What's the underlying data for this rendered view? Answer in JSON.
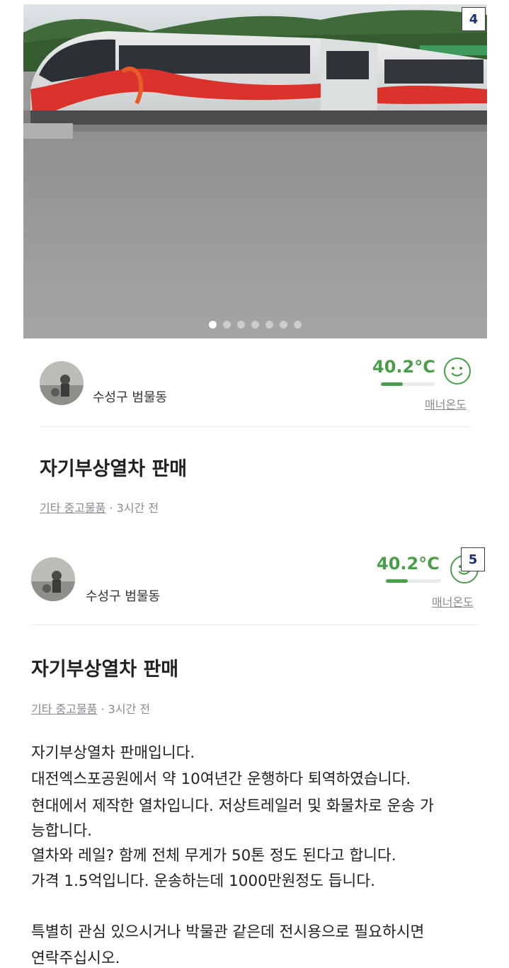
{
  "photo": {
    "marker": "4",
    "slide_count": 7,
    "active_slide": 1
  },
  "card_a": {
    "location": "수성구 범물동",
    "temperature": "40.2°C",
    "temperature_fill": 0.402,
    "manner_label": "매너온도",
    "title": "자기부상열차 판매",
    "category": "기타 중고물품",
    "time_ago": " · 3시간 전"
  },
  "card_b": {
    "marker": "5",
    "location": "수성구 범물동",
    "temperature": "40.2°C",
    "temperature_fill": 0.402,
    "manner_label": "매너온도",
    "title": "자기부상열차 판매",
    "category": "기타 중고물품",
    "time_ago": " · 3시간 전",
    "description": [
      "자기부상열차 판매입니다.",
      "대전엑스포공원에서 약 10여년간 운행하다 퇴역하였습니다.",
      "현대에서 제작한 열차입니다. 저상트레일러 및 화물차로 운송 가",
      "능합니다.",
      "열차와 레일? 함께 전체 무게가 50톤 정도 된다고 합니다.",
      "가격 1.5억입니다. 운송하는데 1000만원정도 듭니다.",
      "",
      "특별히 관심 있으시거나 박물관 같은데 전시용으로 필요하시면",
      "연락주십시오."
    ]
  },
  "colors": {
    "accent_green": "#4a9e4a",
    "marker_text": "#1e2f6e",
    "muted": "#868b94"
  }
}
